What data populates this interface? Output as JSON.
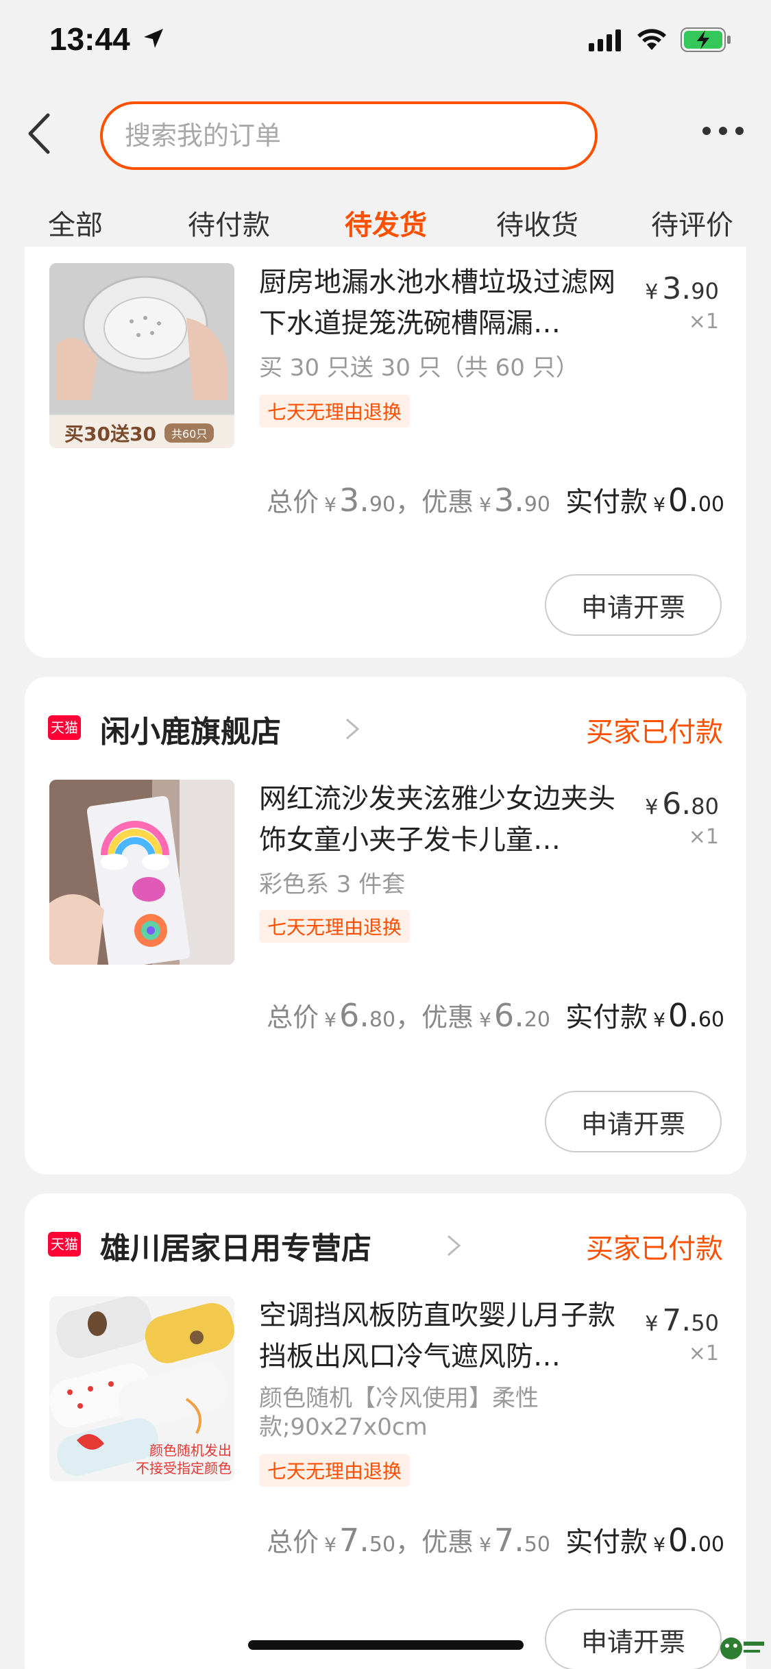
{
  "status_bar": {
    "time": "13:44"
  },
  "search": {
    "placeholder": "搜索我的订单"
  },
  "tabs": [
    {
      "label": "全部"
    },
    {
      "label": "待付款"
    },
    {
      "label": "待发货"
    },
    {
      "label": "待收货"
    },
    {
      "label": "待评价"
    }
  ],
  "active_tab": "待发货",
  "orders": [
    {
      "product_title": "厨房地漏水池水槽垃圾过滤网下水道提笼洗碗槽隔漏…",
      "price_int": "3.",
      "price_dec": "90",
      "qty": "×1",
      "spec": "买 30 只送 30 只（共 60 只）",
      "return_label": "七天无理由退换",
      "thumb_caption": "买30送30",
      "thumb_badge": "共60只",
      "total_label": "总价",
      "total_int": "3.",
      "total_dec": "90",
      "discount_label": "，优惠",
      "discount_int": "3.",
      "discount_dec": "90",
      "paid_label": "实付款",
      "paid_int": "0.",
      "paid_dec": "00",
      "invoice_label": "申请开票"
    },
    {
      "badge": "天猫",
      "shop_name": "闲小鹿旗舰店",
      "status": "买家已付款",
      "product_title": "网红流沙发夹泫雅少女边夹头饰女童小夹子发卡儿童…",
      "price_int": "6.",
      "price_dec": "80",
      "qty": "×1",
      "spec": "彩色系 3 件套",
      "return_label": "七天无理由退换",
      "total_label": "总价",
      "total_int": "6.",
      "total_dec": "80",
      "discount_label": "，优惠",
      "discount_int": "6.",
      "discount_dec": "20",
      "paid_label": "实付款",
      "paid_int": "0.",
      "paid_dec": "60",
      "invoice_label": "申请开票"
    },
    {
      "badge": "天猫",
      "shop_name": "雄川居家日用专营店",
      "status": "买家已付款",
      "product_title": "空调挡风板防直吹婴儿月子款挡板出风口冷气遮风防…",
      "price_int": "7.",
      "price_dec": "50",
      "qty": "×1",
      "spec": "颜色随机【冷风使用】柔性款;90x27x0cm",
      "return_label": "七天无理由退换",
      "thumb_caption": "颜色随机发出\n不接受指定颜色",
      "total_label": "总价",
      "total_int": "7.",
      "total_dec": "50",
      "discount_label": "，优惠",
      "discount_int": "7.",
      "discount_dec": "50",
      "paid_label": "实付款",
      "paid_int": "0.",
      "paid_dec": "00",
      "invoice_label": "申请开票"
    }
  ],
  "currency_symbol": "¥",
  "colors": {
    "accent": "#ff5000",
    "tmall": "#ff0036",
    "background": "#f2f2f2"
  }
}
